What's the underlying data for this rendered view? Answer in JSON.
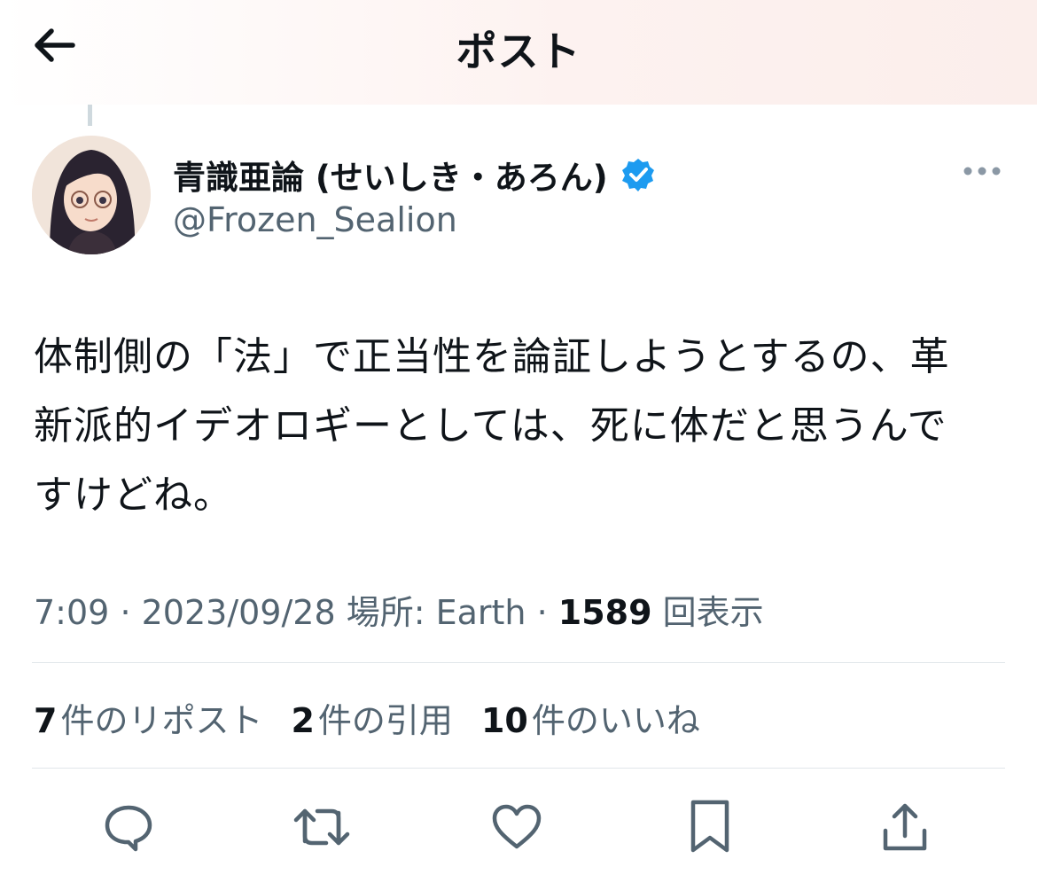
{
  "header": {
    "title": "ポスト"
  },
  "author": {
    "display_name": "青識亜論 (せいしき・あろん)",
    "handle": "@Frozen_Sealion",
    "verified": true,
    "verified_color": "#1d9bf0"
  },
  "post": {
    "lines": [
      "体制側の「法」で正当性を論証しようとするの、革",
      "新派的イデオロギーとしては、死に体だと思うんで",
      "すけどね。"
    ]
  },
  "meta": {
    "time": "7:09",
    "date": "2023/09/28",
    "location": "場所: Earth",
    "views_count": "1589",
    "views_label": "回表示"
  },
  "stats": {
    "reposts_count": "7",
    "reposts_label": "件のリポスト",
    "quotes_count": "2",
    "quotes_label": "件の引用",
    "likes_count": "10",
    "likes_label": "件のいいね"
  },
  "actions": [
    "reply-icon",
    "repost-icon",
    "like-icon",
    "bookmark-icon",
    "share-icon"
  ],
  "colors": {
    "text": "#0f1419",
    "secondary": "#536471",
    "divider": "#e1e6ea"
  }
}
